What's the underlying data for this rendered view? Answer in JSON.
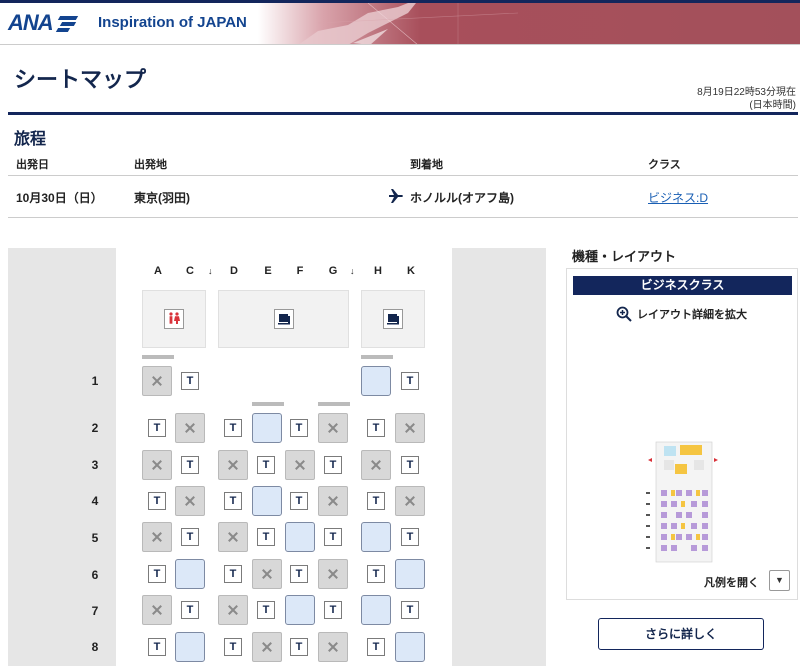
{
  "header": {
    "logo_text": "ANA",
    "tagline": "Inspiration of JAPAN",
    "accent_color": "#13265c",
    "banner_color": "#a3505b"
  },
  "page": {
    "title": "シートマップ",
    "timestamp_line1": "8月19日22時53分現在",
    "timestamp_line2": "(日本時間)"
  },
  "itinerary": {
    "title": "旅程",
    "headers": {
      "date": "出発日",
      "origin": "出発地",
      "destination": "到着地",
      "class": "クラス"
    },
    "date": "10月30日（日）",
    "origin": "東京(羽田)",
    "destination": "ホノルル(オアフ島)",
    "class_link": "ビジネス:D"
  },
  "seatmap": {
    "columns": [
      "A",
      "C",
      "D",
      "E",
      "F",
      "G",
      "H",
      "K"
    ],
    "aisle_arrow": "↓",
    "rows": [
      "1",
      "2",
      "3",
      "4",
      "5",
      "6",
      "7",
      "8"
    ],
    "seat_badge": "T"
  },
  "panel": {
    "title": "機種・レイアウト",
    "class_banner": "ビジネスクラス",
    "zoom_link": "レイアウト詳細を拡大",
    "legend_link": "凡例を開く",
    "more_button": "さらに詳しく"
  }
}
